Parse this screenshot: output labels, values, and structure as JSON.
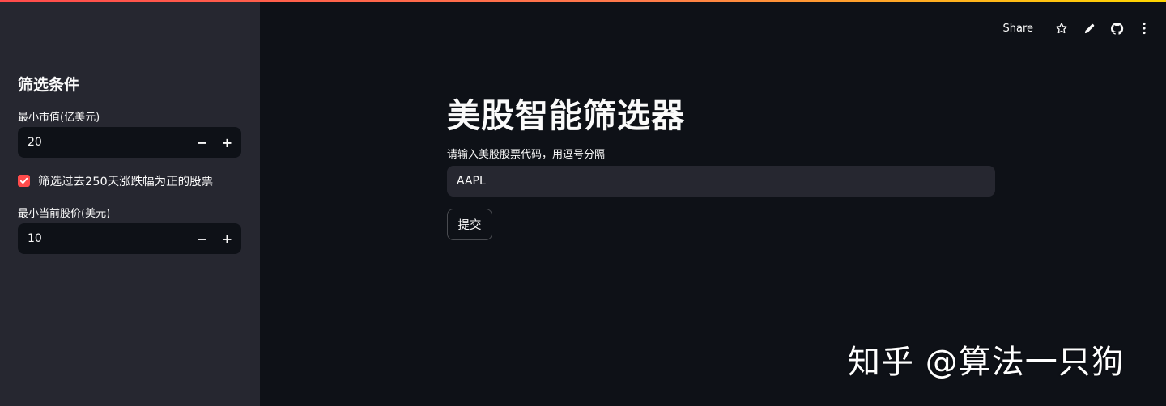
{
  "colors": {
    "background": "#0e1117",
    "sidebar": "#262730",
    "accent": "#ff4b4b",
    "text": "#fafafa"
  },
  "toolbar": {
    "share_label": "Share",
    "icons": [
      "star-icon",
      "pencil-icon",
      "github-icon",
      "more-vertical-icon"
    ]
  },
  "sidebar": {
    "title": "筛选条件",
    "min_market_cap": {
      "label": "最小市值(亿美元)",
      "value": "20",
      "decrement": "−",
      "increment": "+"
    },
    "positive_return_filter": {
      "label": "筛选过去250天涨跌幅为正的股票",
      "checked": true
    },
    "min_price": {
      "label": "最小当前股价(美元)",
      "value": "10",
      "decrement": "−",
      "increment": "+"
    }
  },
  "main": {
    "title": "美股智能筛选器",
    "input_label": "请输入美股股票代码，用逗号分隔",
    "input_value": "AAPL",
    "submit_label": "提交"
  },
  "watermark": "知乎 @算法一只狗"
}
